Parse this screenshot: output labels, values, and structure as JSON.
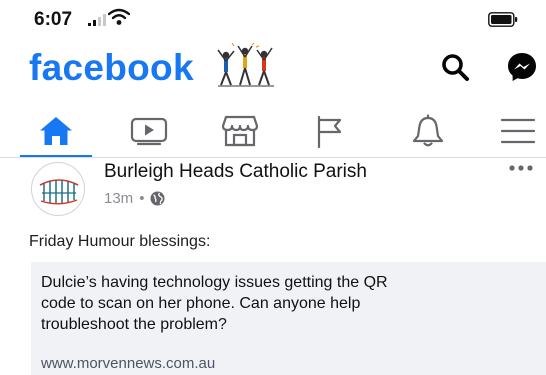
{
  "status_bar": {
    "time": "6:07",
    "icons": [
      "signal-icon",
      "wifi-icon",
      "battery-icon"
    ]
  },
  "header": {
    "logo": "facebook",
    "actions": [
      "search-icon",
      "messenger-icon"
    ]
  },
  "nav": {
    "tabs": [
      {
        "name": "home",
        "icon": "home-icon",
        "active": true
      },
      {
        "name": "watch",
        "icon": "video-icon"
      },
      {
        "name": "marketplace",
        "icon": "store-icon"
      },
      {
        "name": "pages",
        "icon": "flag-icon"
      },
      {
        "name": "notifications",
        "icon": "bell-icon"
      },
      {
        "name": "menu",
        "icon": "hamburger-icon"
      }
    ]
  },
  "post": {
    "page_name": "Burleigh Heads Catholic Parish",
    "time": "13m",
    "separator": "•",
    "privacy_icon": "globe-icon",
    "text": "Friday Humour blessings:",
    "shared": {
      "lines": [
        "Dulcie’s having technology issues getting the QR",
        "code to scan on her phone. Can anyone help",
        "troubleshoot the problem?"
      ],
      "link": "www.morvennews.com.au"
    }
  },
  "colors": {
    "brand": "#1877f2",
    "card_bg": "#f0f2f5",
    "meta": "#8a8d91"
  }
}
